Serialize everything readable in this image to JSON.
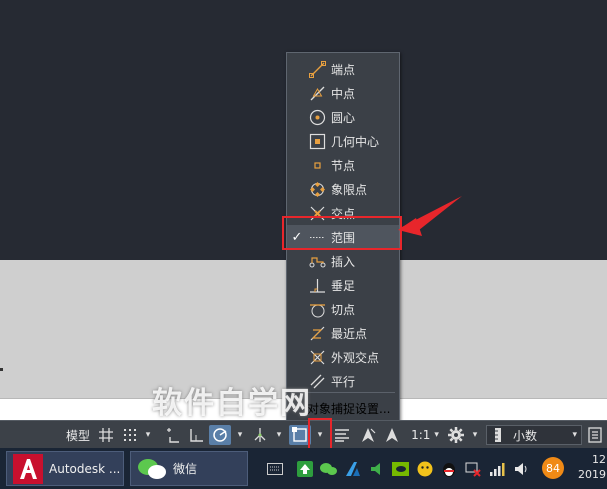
{
  "menu": {
    "items": [
      {
        "label": "端点",
        "icon": "endpoint-snap-icon",
        "checked": false
      },
      {
        "label": "中点",
        "icon": "midpoint-snap-icon",
        "checked": false
      },
      {
        "label": "圆心",
        "icon": "center-snap-icon",
        "checked": false
      },
      {
        "label": "几何中心",
        "icon": "geometric-center-snap-icon",
        "checked": false
      },
      {
        "label": "节点",
        "icon": "node-snap-icon",
        "checked": false
      },
      {
        "label": "象限点",
        "icon": "quadrant-snap-icon",
        "checked": false
      },
      {
        "label": "交点",
        "icon": "intersection-snap-icon",
        "checked": false
      },
      {
        "label": "范围",
        "icon": "extension-snap-icon",
        "checked": true
      },
      {
        "label": "插入",
        "icon": "insertion-snap-icon",
        "checked": false
      },
      {
        "label": "垂足",
        "icon": "perpendicular-snap-icon",
        "checked": false
      },
      {
        "label": "切点",
        "icon": "tangent-snap-icon",
        "checked": false
      },
      {
        "label": "最近点",
        "icon": "nearest-snap-icon",
        "checked": false
      },
      {
        "label": "外观交点",
        "icon": "apparent-intersection-snap-icon",
        "checked": false
      },
      {
        "label": "平行",
        "icon": "parallel-snap-icon",
        "checked": false
      }
    ],
    "settings_label": "对象捕捉设置...",
    "check_mark": "✓"
  },
  "statusbar": {
    "model_label": "模型",
    "scale_label": "1:1",
    "units_label": "小数",
    "drop_glyph": "▾"
  },
  "watermark": "软件自学网",
  "taskbar": {
    "autocad_label": "Autodesk ...",
    "wechat_label": "微信",
    "badge_value": "84",
    "clock_line1": "12",
    "clock_line2": "2019"
  },
  "colors": {
    "menu_bg": "#3b4047",
    "highlight_red": "#e8262b",
    "active_blue": "#5a7fa8",
    "icon_orange": "#e8a040"
  }
}
